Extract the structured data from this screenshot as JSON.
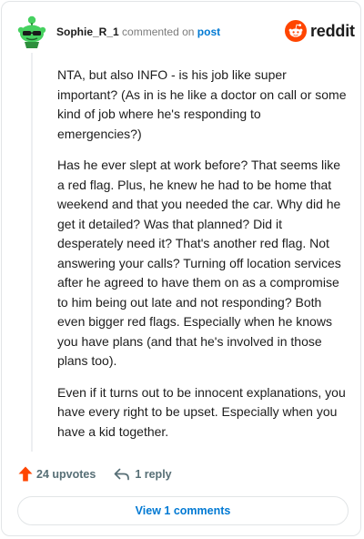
{
  "comment": {
    "username": "Sophie_R_1",
    "action_text": "commented on",
    "post_link": "post",
    "paragraphs": [
      "NTA, but also INFO - is his job like super important? (As in is he like a doctor on call or some kind of job where he's responding to emergencies?)",
      "Has he ever slept at work before? That seems like a red flag. Plus, he knew he had to be home that weekend and that you needed the car. Why did he get it detailed? Was that planned? Did it desperately need it? That's another red flag. Not answering your calls? Turning off location services after he agreed to have them on as a compromise to him being out late and not responding? Both even bigger red flags. Especially when he knows you have plans (and that he's involved in those plans too).",
      "Even if it turns out to be innocent explanations, you have every right to be upset. Especially when you have a kid together."
    ]
  },
  "brand": {
    "name": "reddit",
    "color": "#ff4500"
  },
  "actions": {
    "upvotes": "24 upvotes",
    "replies": "1 reply",
    "upvote_color": "#ff4500"
  },
  "footer": {
    "view_comments": "View 1 comments"
  },
  "icons": {
    "avatar": "snoo-avatar-icon",
    "logo": "reddit-logo-icon",
    "upvote": "upvote-arrow-icon",
    "reply": "reply-arrow-icon"
  }
}
